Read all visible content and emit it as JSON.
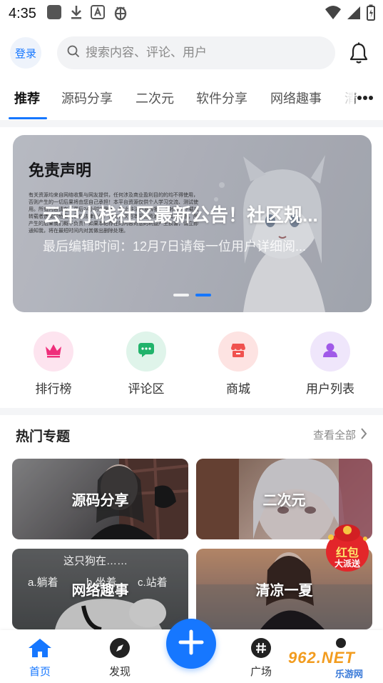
{
  "status_bar": {
    "time": "4:35"
  },
  "header": {
    "login_label": "登录",
    "search_placeholder": "搜索内容、评论、用户"
  },
  "tabs": [
    {
      "label": "推荐",
      "active": true
    },
    {
      "label": "源码分享",
      "active": false
    },
    {
      "label": "二次元",
      "active": false
    },
    {
      "label": "软件分享",
      "active": false
    },
    {
      "label": "网络趣事",
      "active": false
    },
    {
      "label": "清",
      "active": false
    }
  ],
  "banner": {
    "overlay_title": "云中小栈社区最新公告！社区规...",
    "overlay_subtitle": "最后编辑时间：12月7日请每一位用户详细阅...",
    "image_heading": "免责声明",
    "image_text": "有关资源均来自网络收集与网友提供，任何涉及商业盈利目的的均不得使用，否则产生的一切后果将由您自己承担！本平台资源仅供个人学习交流、测试使用。所有内容请在下载后24小时内删除，禁止非法恶意传播，不对任何下载或转载者造成的危害负任何法律责任！请勿再次由本平台资源用于其他用途，所产生的后果我们概不负责！如果本帖存在的内容对您的利益产生损害，请立即通知我，将在最短时间内对其做出删除处理。",
    "page_count": 2,
    "current_page": 2
  },
  "quick_entries": [
    {
      "label": "排行榜",
      "icon": "crown-icon",
      "bg": "#fde4ef",
      "fg": "#ef2f7b"
    },
    {
      "label": "评论区",
      "icon": "chat-bubble-icon",
      "bg": "#dff4ea",
      "fg": "#21b36b"
    },
    {
      "label": "商城",
      "icon": "shop-icon",
      "bg": "#fde3e2",
      "fg": "#f0524f"
    },
    {
      "label": "用户列表",
      "icon": "user-icon",
      "bg": "#efe6fb",
      "fg": "#a05ae8"
    }
  ],
  "hot_topics": {
    "title": "热门专题",
    "see_all": "查看全部",
    "cards": [
      {
        "label": "源码分享"
      },
      {
        "label": "二次元"
      },
      {
        "label": "网络趣事"
      },
      {
        "label": "清凉一夏"
      }
    ]
  },
  "meme_text": {
    "line1": "这只狗在……",
    "a": "a.躺着",
    "b": "b.坐着",
    "c": "c.站着"
  },
  "red_packet": {
    "line1": "红包",
    "line2": "大派送"
  },
  "bottom_nav": {
    "items": [
      {
        "label": "首页",
        "icon": "home-icon",
        "active": true
      },
      {
        "label": "发现",
        "icon": "compass-icon",
        "active": false
      },
      {
        "label": "广场",
        "icon": "hashtag-icon",
        "active": false
      },
      {
        "label": "",
        "icon": "profile-icon",
        "active": false
      }
    ]
  },
  "watermark": {
    "brand": "962.NET",
    "sub": "乐游网"
  },
  "colors": {
    "accent": "#1677ff"
  }
}
